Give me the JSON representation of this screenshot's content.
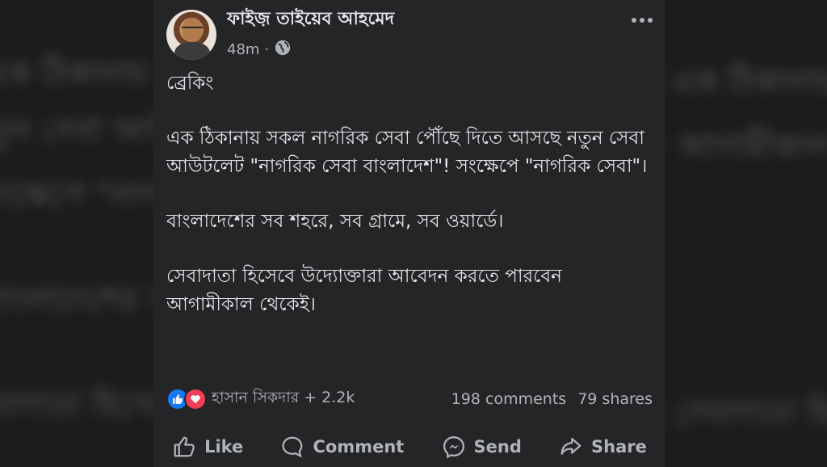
{
  "background_lines": [
    "এক ঠিকানায় সকল নাগরিক",
    "নতুন সেবা আউটলেট",
    "সংক্ষেপে \"নাগরিক",
    "বাংলাদেশের সব",
    "সেবাদাতা হিসেবে",
    "আগামীকাল থেকেই"
  ],
  "post": {
    "author": "ফাইজ় তাইয়েব আহমেদ",
    "time": "48m",
    "privacy_sep": "·",
    "privacy_icon": "globe-icon",
    "paragraphs": [
      "ব্রেকিং",
      "এক ঠিকানায় সকল নাগরিক সেবা পৌঁছে দিতে আসছে নতুন সেবা আউটলেট \"নাগরিক সেবা বাংলাদেশ\"! সংক্ষেপে \"নাগরিক সেবা\"।",
      "বাংলাদেশের সব শহরে, সব গ্রামে, সব ওয়ার্ডে।",
      "সেবাদাতা হিসেবে উদ্যোক্তারা আবেদন করতে পারবেন আগামীকাল থেকেই।"
    ],
    "reactions": {
      "icons": [
        "like-icon",
        "love-icon"
      ],
      "summary": "হাসান সিকদার + 2.2k",
      "comments": "198 comments",
      "shares": "79 shares"
    },
    "actions": {
      "like": "Like",
      "comment": "Comment",
      "send": "Send",
      "share": "Share"
    }
  },
  "colors": {
    "page_bg": "#1c1c1d",
    "card_bg": "#242526",
    "text": "#e4e6eb",
    "muted": "#b0b3b8",
    "like_blue": "#1877f2",
    "love_red": "#f33e58"
  }
}
